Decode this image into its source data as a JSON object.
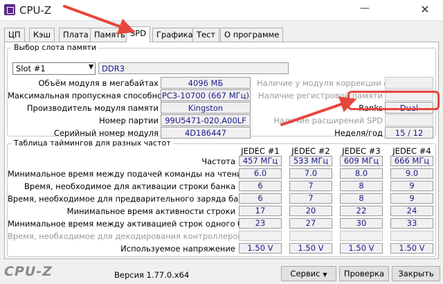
{
  "window": {
    "title": "CPU-Z",
    "minimize_glyph": "—",
    "close_glyph": "✕"
  },
  "tabs": [
    {
      "label": "ЦП"
    },
    {
      "label": "Кэш"
    },
    {
      "label": "Плата"
    },
    {
      "label": "Память"
    },
    {
      "label": "SPD",
      "active": true
    },
    {
      "label": "Графика"
    },
    {
      "label": "Тест"
    },
    {
      "label": "О программе"
    }
  ],
  "slot_group": {
    "title": "Выбор слота памяти",
    "slot_select": "Slot #1",
    "memory_type": "DDR3",
    "left_labels": {
      "module_size": "Объём модуля в мегабайтах",
      "max_bandwidth": "Максимальная пропускная способность",
      "manufacturer": "Производитель модуля памяти",
      "part_number": "Номер партии",
      "serial": "Серийный номер модуля"
    },
    "left_values": {
      "module_size": "4096 МБ",
      "max_bandwidth": "PC3-10700 (667 МГц)",
      "manufacturer": "Kingston",
      "part_number": "99U5471-020.A00LF",
      "serial": "4D186447"
    },
    "right_labels": {
      "ecc": "Наличие у модуля коррекции ошибок",
      "registered": "Наличие регистровой памяти",
      "ranks": "Ranks",
      "spd_ext": "Наличие расширений SPD",
      "week_year": "Неделя/год"
    },
    "right_values": {
      "ranks": "Dual",
      "week_year": "15 / 12"
    }
  },
  "timings_group": {
    "title": "Таблица таймингов для разных частот",
    "columns": [
      "JEDEC #1",
      "JEDEC #2",
      "JEDEC #3",
      "JEDEC #4"
    ],
    "rows": [
      {
        "label": "Частота",
        "values": [
          "457 МГц",
          "533 МГц",
          "609 МГц",
          "666 МГц"
        ]
      },
      {
        "label": "Минимальное время между подачей команды на чтение",
        "values": [
          "6.0",
          "7.0",
          "8.0",
          "9.0"
        ]
      },
      {
        "label": "Время, необходимое для активации строки банка",
        "values": [
          "6",
          "7",
          "8",
          "9"
        ]
      },
      {
        "label": "Время, необходимое для предварительного заряда банка",
        "values": [
          "6",
          "7",
          "8",
          "9"
        ]
      },
      {
        "label": "Минимальное время активности строки",
        "values": [
          "17",
          "20",
          "22",
          "24"
        ]
      },
      {
        "label": "Минимальное время между активацией строк одного банка",
        "values": [
          "23",
          "27",
          "30",
          "33"
        ]
      },
      {
        "label": "Время, необходимое для декодирования контроллером",
        "values": [
          "",
          "",
          "",
          ""
        ],
        "disabled": true
      },
      {
        "label": "Используемое напряжение",
        "values": [
          "1.50 V",
          "1.50 V",
          "1.50 V",
          "1.50 V"
        ]
      }
    ]
  },
  "footer": {
    "brand": "CPU-Z",
    "version": "Версия 1.77.0.x64",
    "service_button": "Сервис",
    "validate_button": "Проверка",
    "close_button": "Закрыть"
  },
  "colors": {
    "annotation": "#e8453c",
    "value_text": "#1a1a8c"
  },
  "icons": {
    "slot_dropdown": "chevron-down-icon",
    "service_dropdown": "triangle-down-icon"
  }
}
